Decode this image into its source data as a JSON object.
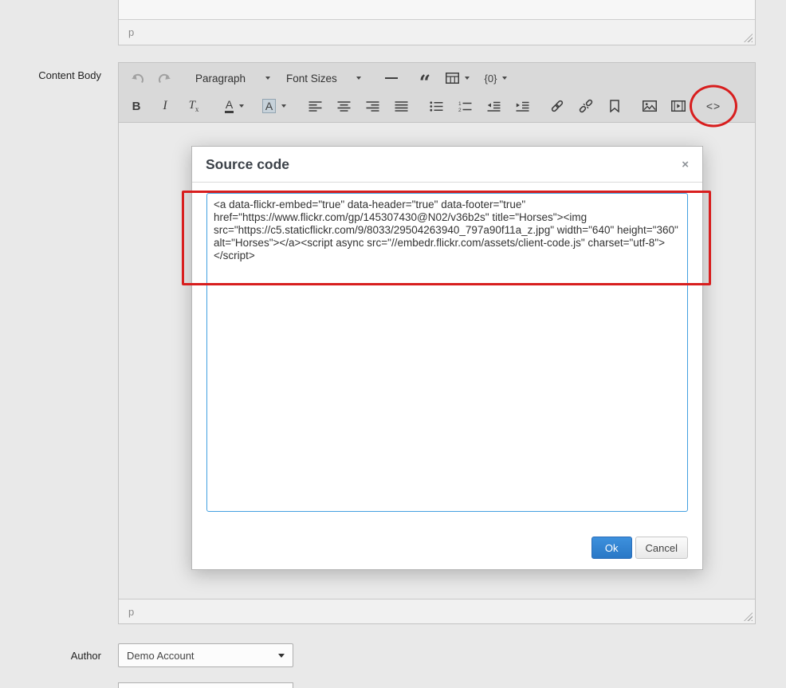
{
  "labels": {
    "content_body": "Content Body",
    "author": "Author"
  },
  "editor_above": {
    "element_path": "p"
  },
  "content_editor": {
    "element_path": "p",
    "toolbar_row1": {
      "paragraph_label": "Paragraph",
      "font_sizes_label": "Font Sizes",
      "blockquote_glyph": "“",
      "token_label": "{0}"
    },
    "toolbar_row2": {
      "bold_label": "B",
      "italic_label": "I",
      "clear_formatting_t": "T",
      "clear_formatting_x": "x",
      "forecolor_label": "A",
      "backcolor_label": "A",
      "source_code_label": "<>"
    }
  },
  "dialog": {
    "title": "Source code",
    "close_glyph": "×",
    "source_code": "<a data-flickr-embed=\"true\" data-header=\"true\" data-footer=\"true\" href=\"https://www.flickr.com/gp/145307430@N02/v36b2s\" title=\"Horses\"><img src=\"https://c5.staticflickr.com/9/8033/29504263940_797a90f11a_z.jpg\" width=\"640\" height=\"360\" alt=\"Horses\"></a><script async src=\"//embedr.flickr.com/assets/client-code.js\" charset=\"utf-8\"></script>",
    "ok_label": "Ok",
    "cancel_label": "Cancel"
  },
  "author_field": {
    "selected_option": "Demo Account"
  },
  "colors": {
    "annotation_red": "#d81e1e",
    "primary_button_blue": "#2f80d0",
    "textarea_focus_border": "#43a0e0",
    "toolbar_gray": "#d9d9d9"
  }
}
